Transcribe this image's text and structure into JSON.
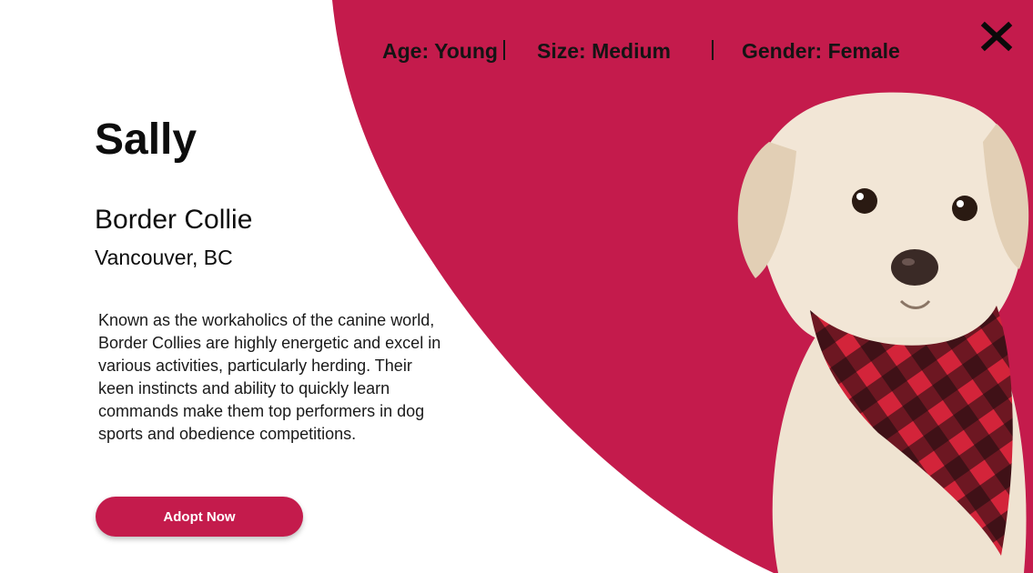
{
  "pet": {
    "name": "Sally",
    "breed": "Border Collie",
    "location": "Vancouver, BC",
    "description": "Known as the workaholics of the canine world, Border Collies are highly energetic and excel in various activities, particularly herding. Their keen instincts and ability to quickly learn commands make them top performers in dog sports and obedience competitions."
  },
  "attributes": {
    "age": "Age: Young",
    "size": "Size: Medium",
    "gender": "Gender: Female"
  },
  "close_label": "X",
  "adopt_label": "Adopt Now",
  "colors": {
    "accent": "#c41b4c",
    "background": "#ffffff",
    "text": "#111111"
  },
  "icons": {
    "close": "close-icon",
    "photo": "dog-photo"
  }
}
